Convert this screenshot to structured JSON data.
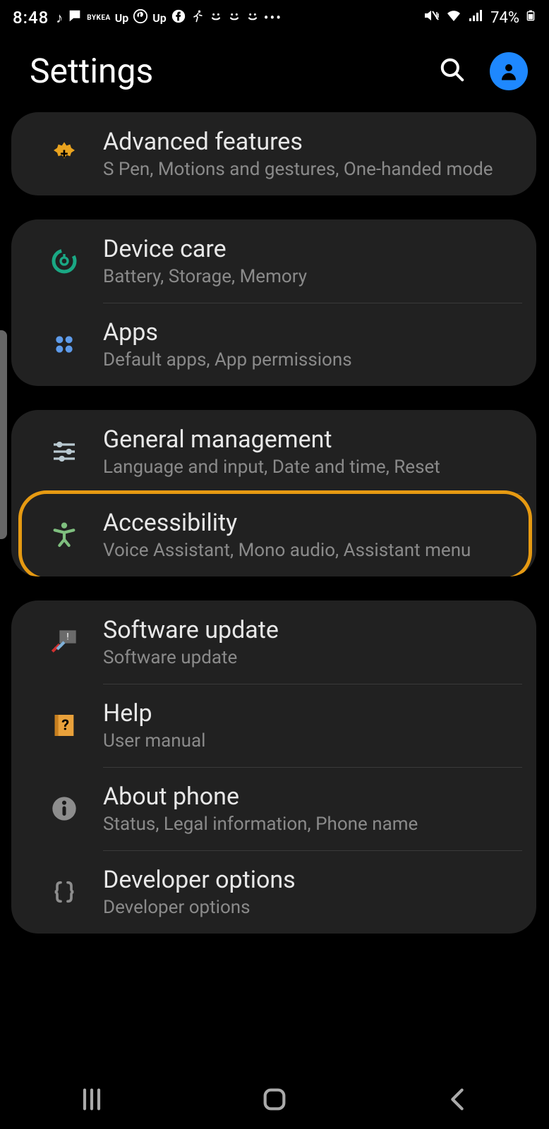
{
  "status": {
    "time": "8:48",
    "battery": "74%",
    "left_icons": [
      "music-note",
      "message",
      "bykea",
      "up",
      "pinterest",
      "up",
      "facebook",
      "running",
      "smile",
      "smile",
      "smile",
      "more"
    ],
    "bykea_text": "BYKEA",
    "up_text": "Up"
  },
  "header": {
    "title": "Settings"
  },
  "groups": [
    {
      "items": [
        {
          "id": "advanced-features",
          "title": "Advanced features",
          "sub": "S Pen, Motions and gestures, One-handed mode",
          "icon": "gear-plus",
          "color": "#e9a31f"
        }
      ]
    },
    {
      "items": [
        {
          "id": "device-care",
          "title": "Device care",
          "sub": "Battery, Storage, Memory",
          "icon": "device-care",
          "color": "#1aa884"
        },
        {
          "id": "apps",
          "title": "Apps",
          "sub": "Default apps, App permissions",
          "icon": "apps",
          "color": "#5e9bea"
        }
      ]
    },
    {
      "items": [
        {
          "id": "general-management",
          "title": "General management",
          "sub": "Language and input, Date and time, Reset",
          "icon": "sliders",
          "color": "#b9c9d1"
        },
        {
          "id": "accessibility",
          "title": "Accessibility",
          "sub": "Voice Assistant, Mono audio, Assistant menu",
          "icon": "accessibility",
          "color": "#7fbf7f",
          "highlighted": true
        }
      ]
    },
    {
      "items": [
        {
          "id": "software-update",
          "title": "Software update",
          "sub": "Software update",
          "icon": "update",
          "color": "#999999"
        },
        {
          "id": "help",
          "title": "Help",
          "sub": "User manual",
          "icon": "help-book",
          "color": "#e9a13b"
        },
        {
          "id": "about-phone",
          "title": "About phone",
          "sub": "Status, Legal information, Phone name",
          "icon": "info",
          "color": "#8d8d8d"
        },
        {
          "id": "developer-options",
          "title": "Developer options",
          "sub": "Developer options",
          "icon": "braces",
          "color": "#8d8d8d"
        }
      ]
    }
  ]
}
